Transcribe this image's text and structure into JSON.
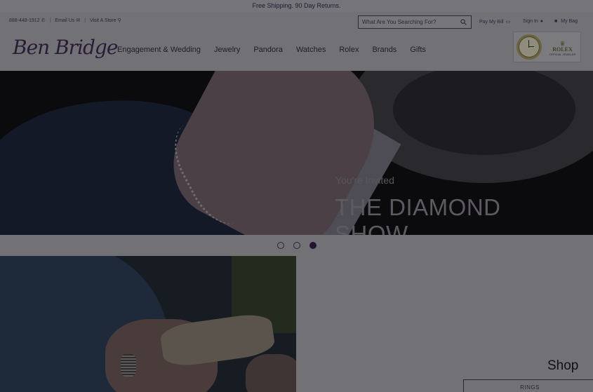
{
  "promo": {
    "text": "Free Shipping. 90 Day Returns."
  },
  "utility": {
    "phone": "888-448-1912",
    "email_label": "Email Us",
    "store_label": "Visit A Store"
  },
  "search": {
    "placeholder": "What Are You Searching For?"
  },
  "account": {
    "pay_bill": "Pay My Bill",
    "sign_in": "Sign In",
    "bag": "My Bag"
  },
  "brand": {
    "logo_text": "Ben Bridge"
  },
  "nav": {
    "items": [
      "Engagement & Wedding",
      "Jewelry",
      "Pandora",
      "Watches",
      "Rolex",
      "Brands",
      "Gifts"
    ]
  },
  "rolex_badge": {
    "name": "ROLEX",
    "sub": "OFFICIAL JEWELER"
  },
  "hero": {
    "eyebrow": "You're Invited",
    "title": "THE DIAMOND SHOW"
  },
  "carousel": {
    "slide_count": 3,
    "active_index": 2
  },
  "promo_block": {
    "heading": "Shop",
    "button_label": "RINGS"
  },
  "icons": {
    "phone": "phone-icon",
    "email": "envelope-icon",
    "store": "map-pin-icon",
    "search": "search-icon",
    "bill": "credit-card-icon",
    "user": "user-icon",
    "bag": "shopping-bag-icon"
  },
  "colors": {
    "brand": "#221432",
    "overlay": "#727176"
  }
}
